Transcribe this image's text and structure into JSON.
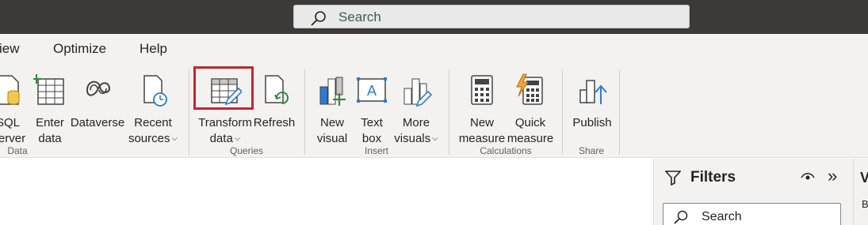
{
  "titlebar": {
    "search_label": "Search"
  },
  "menu": {
    "tabs": [
      "View",
      "Optimize",
      "Help"
    ]
  },
  "ribbon": {
    "groups": {
      "data": "Data",
      "queries": "Queries",
      "insert": "Insert",
      "calculations": "Calculations",
      "share": "Share"
    },
    "buttons": {
      "sql_server": {
        "line1": "SQL",
        "line2": "Server",
        "icon": "database-icon"
      },
      "enter_data": {
        "line1": "Enter",
        "line2": "data",
        "icon": "table-grid-icon"
      },
      "dataverse": {
        "line1": "Dataverse",
        "line2": "",
        "icon": "dataverse-icon"
      },
      "recent_sources": {
        "line1": "Recent",
        "line2": "sources",
        "icon": "document-clock-icon"
      },
      "transform_data": {
        "line1": "Transform",
        "line2": "data",
        "icon": "table-pencil-icon"
      },
      "refresh": {
        "line1": "Refresh",
        "line2": "",
        "icon": "document-refresh-icon"
      },
      "new_visual": {
        "line1": "New",
        "line2": "visual",
        "icon": "bar-chart-plus-icon"
      },
      "text_box": {
        "line1": "Text",
        "line2": "box",
        "icon": "text-box-icon"
      },
      "more_visuals": {
        "line1": "More",
        "line2": "visuals",
        "icon": "chart-pencil-icon"
      },
      "new_measure": {
        "line1": "New",
        "line2": "measure",
        "icon": "calculator-icon"
      },
      "quick_measure": {
        "line1": "Quick",
        "line2": "measure",
        "icon": "calculator-lightning-icon"
      },
      "publish": {
        "line1": "Publish",
        "line2": "",
        "icon": "publish-icon"
      }
    }
  },
  "filters_pane": {
    "title": "Filters",
    "search_placeholder": "Search"
  },
  "visualizations_pane": {
    "title": "V",
    "build_label": "B"
  },
  "colors": {
    "highlight": "#c4262e",
    "accent_green": "#2e8b3d",
    "accent_blue": "#2b7cd3",
    "titlebar": "#3b3a39"
  }
}
